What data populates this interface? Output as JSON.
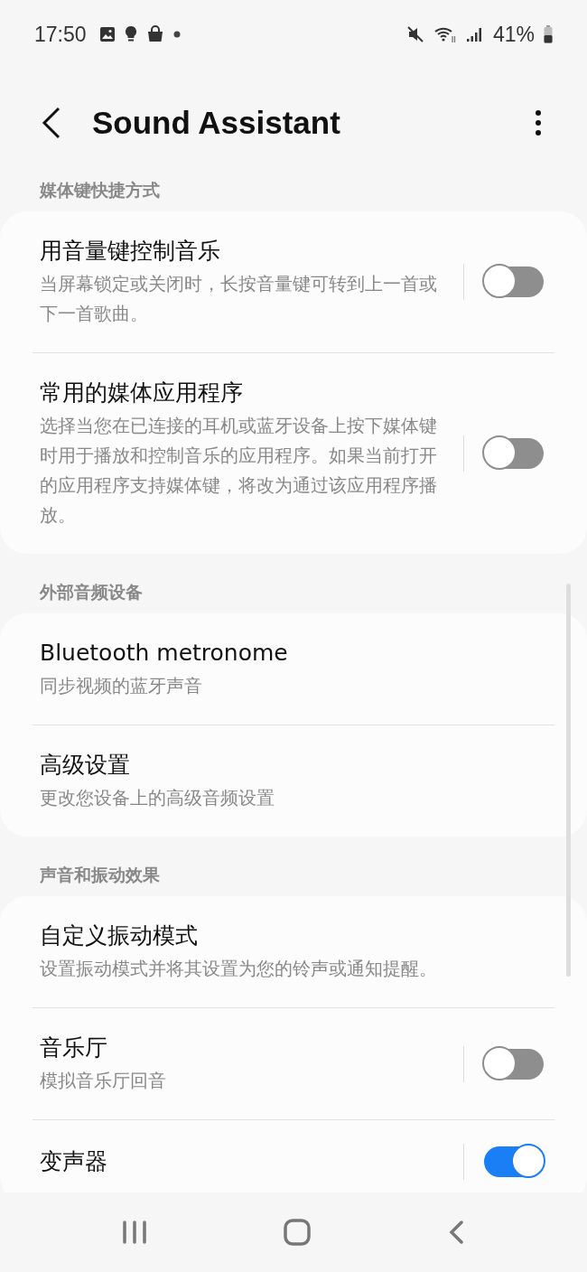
{
  "status_bar": {
    "time": "17:50",
    "battery": "41%"
  },
  "header": {
    "title": "Sound Assistant"
  },
  "sections": [
    {
      "title": "媒体键快捷方式",
      "items": [
        {
          "kind": "toggle",
          "title": "用音量键控制音乐",
          "subtitle": "当屏幕锁定或关闭时，长按音量键可转到上一首或下一首歌曲。",
          "on": false
        },
        {
          "kind": "toggle",
          "title": "常用的媒体应用程序",
          "subtitle": "选择当您在已连接的耳机或蓝牙设备上按下媒体键时用于播放和控制音乐的应用程序。如果当前打开的应用程序支持媒体键，将改为通过该应用程序播放。",
          "on": false
        }
      ]
    },
    {
      "title": "外部音频设备",
      "items": [
        {
          "kind": "link",
          "title": "Bluetooth metronome",
          "subtitle": "同步视频的蓝牙声音"
        },
        {
          "kind": "link",
          "title": "高级设置",
          "subtitle": "更改您设备上的高级音频设置"
        }
      ]
    },
    {
      "title": "声音和振动效果",
      "items": [
        {
          "kind": "link",
          "title": "自定义振动模式",
          "subtitle": "设置振动模式并将其设置为您的铃声或通知提醒。"
        },
        {
          "kind": "toggle",
          "title": "音乐厅",
          "subtitle": "模拟音乐厅回音",
          "on": false
        },
        {
          "kind": "toggle",
          "title": "变声器",
          "on": true
        }
      ]
    }
  ]
}
